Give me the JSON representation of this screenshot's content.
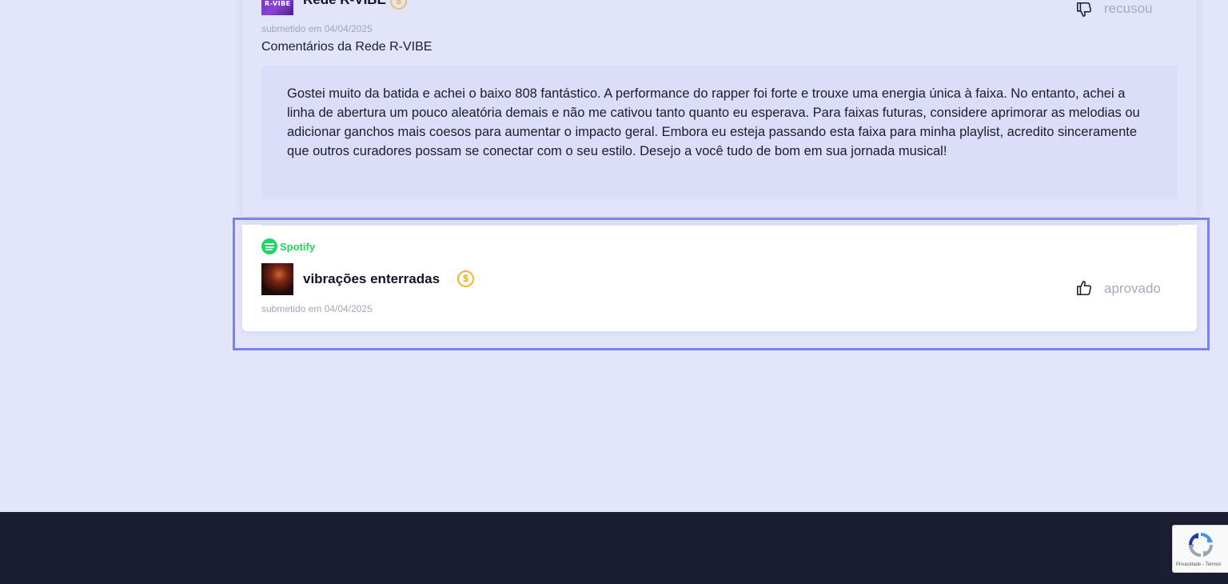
{
  "reviews": [
    {
      "curator_name": "Rede R-VIBE",
      "thumb_text": "R-VIBE",
      "coin_symbol": "$",
      "submitted": "submetido em 04/04/2025",
      "comments_heading": "Comentários da Rede R-VIBE",
      "feedback": "Gostei muito da batida e achei o baixo 808 fantástico. A performance do rapper foi forte e trouxe uma energia única à faixa. No entanto, achei a linha de abertura um pouco aleatória demais e não me cativou tanto quanto eu esperava. Para faixas futuras, considere aprimorar as melodias ou adicionar ganchos mais coesos para aumentar o impacto geral. Embora eu esteja passando esta faixa para minha playlist, acredito sinceramente que outros curadores possam se conectar com o seu estilo. Desejo a você tudo de bom em sua jornada musical!",
      "status": "recusou",
      "status_icon": "thumbs-down-icon"
    },
    {
      "platform": "Spotify",
      "curator_name": "vibrações enterradas",
      "coin_symbol": "$",
      "submitted": "submetido em 04/04/2025",
      "status": "aprovado",
      "status_icon": "thumbs-up-icon"
    }
  ],
  "recaptcha": {
    "links": "Privacidade - Termos"
  },
  "colors": {
    "page_bg": "#e3e5fa",
    "highlight_border": "#7b82ea",
    "spotify_green": "#1ed760",
    "coin_gold": "#f0b429",
    "footer_bg": "#1b1d33"
  }
}
